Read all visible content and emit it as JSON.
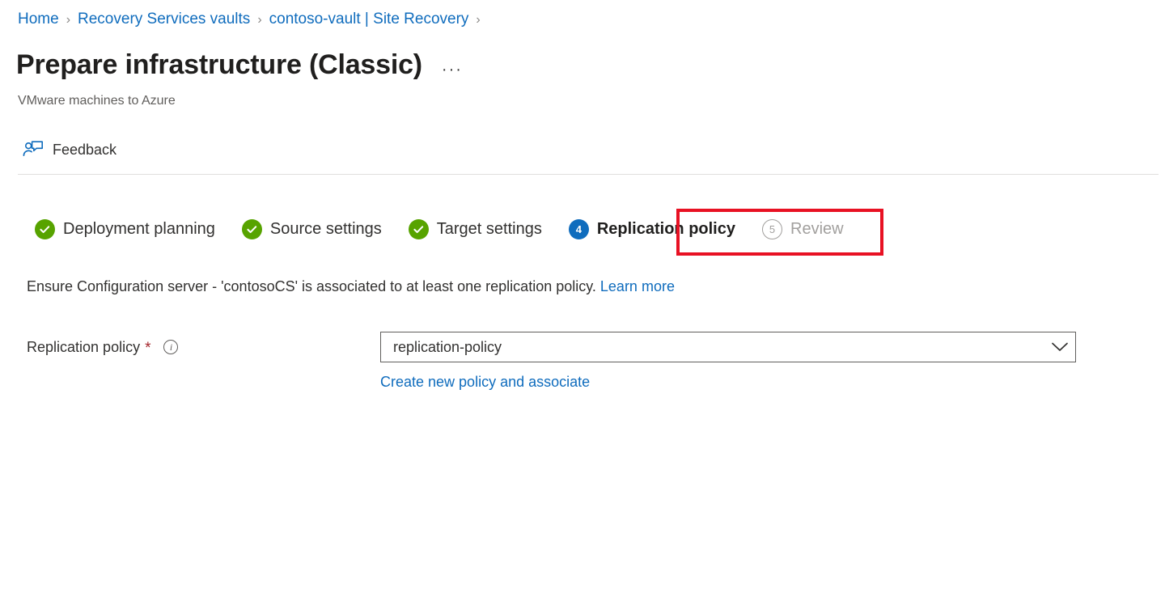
{
  "breadcrumb": {
    "separator": "›",
    "items": [
      {
        "label": "Home"
      },
      {
        "label": "Recovery Services vaults"
      },
      {
        "label": "contoso-vault | Site Recovery"
      }
    ],
    "trailing_separator": "›"
  },
  "header": {
    "title": "Prepare infrastructure (Classic)",
    "more_options": "···",
    "more_options_icon": "ellipsis-icon",
    "subtitle": "VMware machines to Azure"
  },
  "command_bar": {
    "feedback": {
      "label": "Feedback",
      "icon": "feedback-person-speech-bubble-icon"
    }
  },
  "wizard": {
    "steps": [
      {
        "number": "1",
        "label": "Deployment planning",
        "state": "done",
        "badge_icon": "check-circle-icon"
      },
      {
        "number": "2",
        "label": "Source settings",
        "state": "done",
        "badge_icon": "check-circle-icon"
      },
      {
        "number": "3",
        "label": "Target settings",
        "state": "done",
        "badge_icon": "check-circle-icon"
      },
      {
        "number": "4",
        "label": "Replication policy",
        "state": "current",
        "badge_icon": "number-circle-icon"
      },
      {
        "number": "5",
        "label": "Review",
        "state": "pending",
        "badge_icon": "number-circle-icon"
      }
    ]
  },
  "content": {
    "description_text": "Ensure Configuration server - 'contosoCS' is associated to at least one replication policy. ",
    "description_link": "Learn more",
    "form": {
      "label": "Replication policy",
      "required_marker": "*",
      "info_icon": "info-icon",
      "info_tooltip": "i",
      "selected_value": "replication-policy",
      "chevron_icon": "chevron-down-icon",
      "create_link": "Create new policy and associate"
    }
  },
  "colors": {
    "link_blue": "#0f6cbd",
    "step_done_green": "#57a300",
    "step_current_blue": "#0f6cbd",
    "annotation_red": "#e81123",
    "required_red": "#a4262c",
    "muted_grey": "#a19f9d",
    "subtitle_grey": "#605e5c",
    "divider_grey": "#e1dfdd"
  }
}
